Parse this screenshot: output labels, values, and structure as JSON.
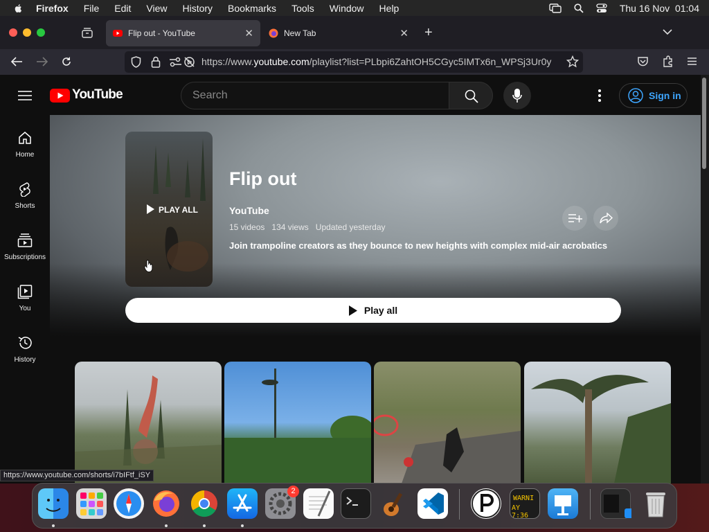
{
  "menubar": {
    "app": "Firefox",
    "items": [
      "File",
      "Edit",
      "View",
      "History",
      "Bookmarks",
      "Tools",
      "Window",
      "Help"
    ],
    "clock": "Thu 16 Nov  01:04"
  },
  "tabs": [
    {
      "title": "Flip out - YouTube",
      "active": true
    },
    {
      "title": "New Tab",
      "active": false
    }
  ],
  "nav": {
    "url_prefix": "https://www.",
    "url_domain": "youtube.com",
    "url_rest": "/playlist?list=PLbpi6ZahtOH5CGyc5IMTx6n_WPSj3Ur0y"
  },
  "youtube": {
    "logo": "YouTube",
    "search_placeholder": "Search",
    "signin": "Sign in",
    "sidebar": [
      {
        "label": "Home",
        "icon": "home-icon"
      },
      {
        "label": "Shorts",
        "icon": "shorts-icon"
      },
      {
        "label": "Subscriptions",
        "icon": "subscriptions-icon"
      },
      {
        "label": "You",
        "icon": "you-icon"
      },
      {
        "label": "History",
        "icon": "history-icon"
      }
    ]
  },
  "playlist": {
    "title": "Flip out",
    "channel": "YouTube",
    "videos": "15 videos",
    "views": "134 views",
    "updated": "Updated yesterday",
    "description": "Join trampoline creators as they bounce to new heights with complex mid-air acrobatics",
    "thumb_play_all": "PLAY ALL",
    "play_all": "Play all"
  },
  "status_url": "https://www.youtube.com/shorts/i7bIFtf_iSY",
  "dock": {
    "settings_badge": "2",
    "console_text_1": "WARNI",
    "console_text_2": "AY 7:36"
  },
  "colors": {
    "yt_red": "#ff0000",
    "link_blue": "#3ea6ff"
  }
}
